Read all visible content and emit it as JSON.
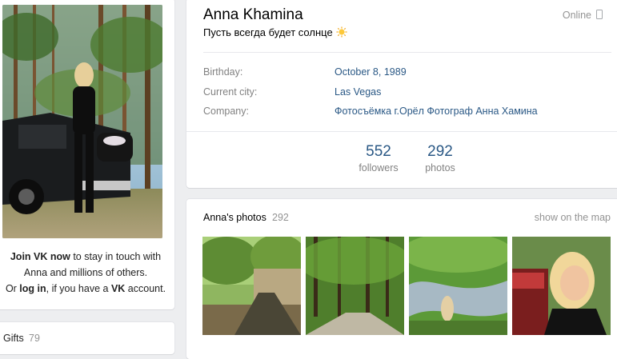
{
  "profile": {
    "name": "Anna Khamina",
    "status": "Пусть всегда будет солнце",
    "status_icon": "sun-emoji",
    "online": "Online",
    "online_icon": "mobile-phone-icon"
  },
  "details": [
    {
      "label": "Birthday:",
      "value": "October 8, 1989"
    },
    {
      "label": "Current city:",
      "value": "Las Vegas"
    },
    {
      "label": "Company:",
      "value": "Фотосъёмка г.Орёл Фотограф Анна Хамина"
    }
  ],
  "counters": [
    {
      "number": "552",
      "label": "followers"
    },
    {
      "number": "292",
      "label": "photos"
    }
  ],
  "join": {
    "line1_bold": "Join VK now",
    "line1_rest": " to stay in touch with",
    "line2": "Anna and millions of others.",
    "line3_a": "Or ",
    "line3_login": "log in",
    "line3_b": ", if you have a ",
    "line3_vk": "VK",
    "line3_c": " account."
  },
  "gifts": {
    "label": "Gifts",
    "count": "79"
  },
  "photos": {
    "title": "Anna's photos",
    "count": "292",
    "map_link": "show on the map"
  },
  "colors": {
    "link": "#2a5885",
    "muted": "#828282",
    "background": "#edeef0"
  }
}
